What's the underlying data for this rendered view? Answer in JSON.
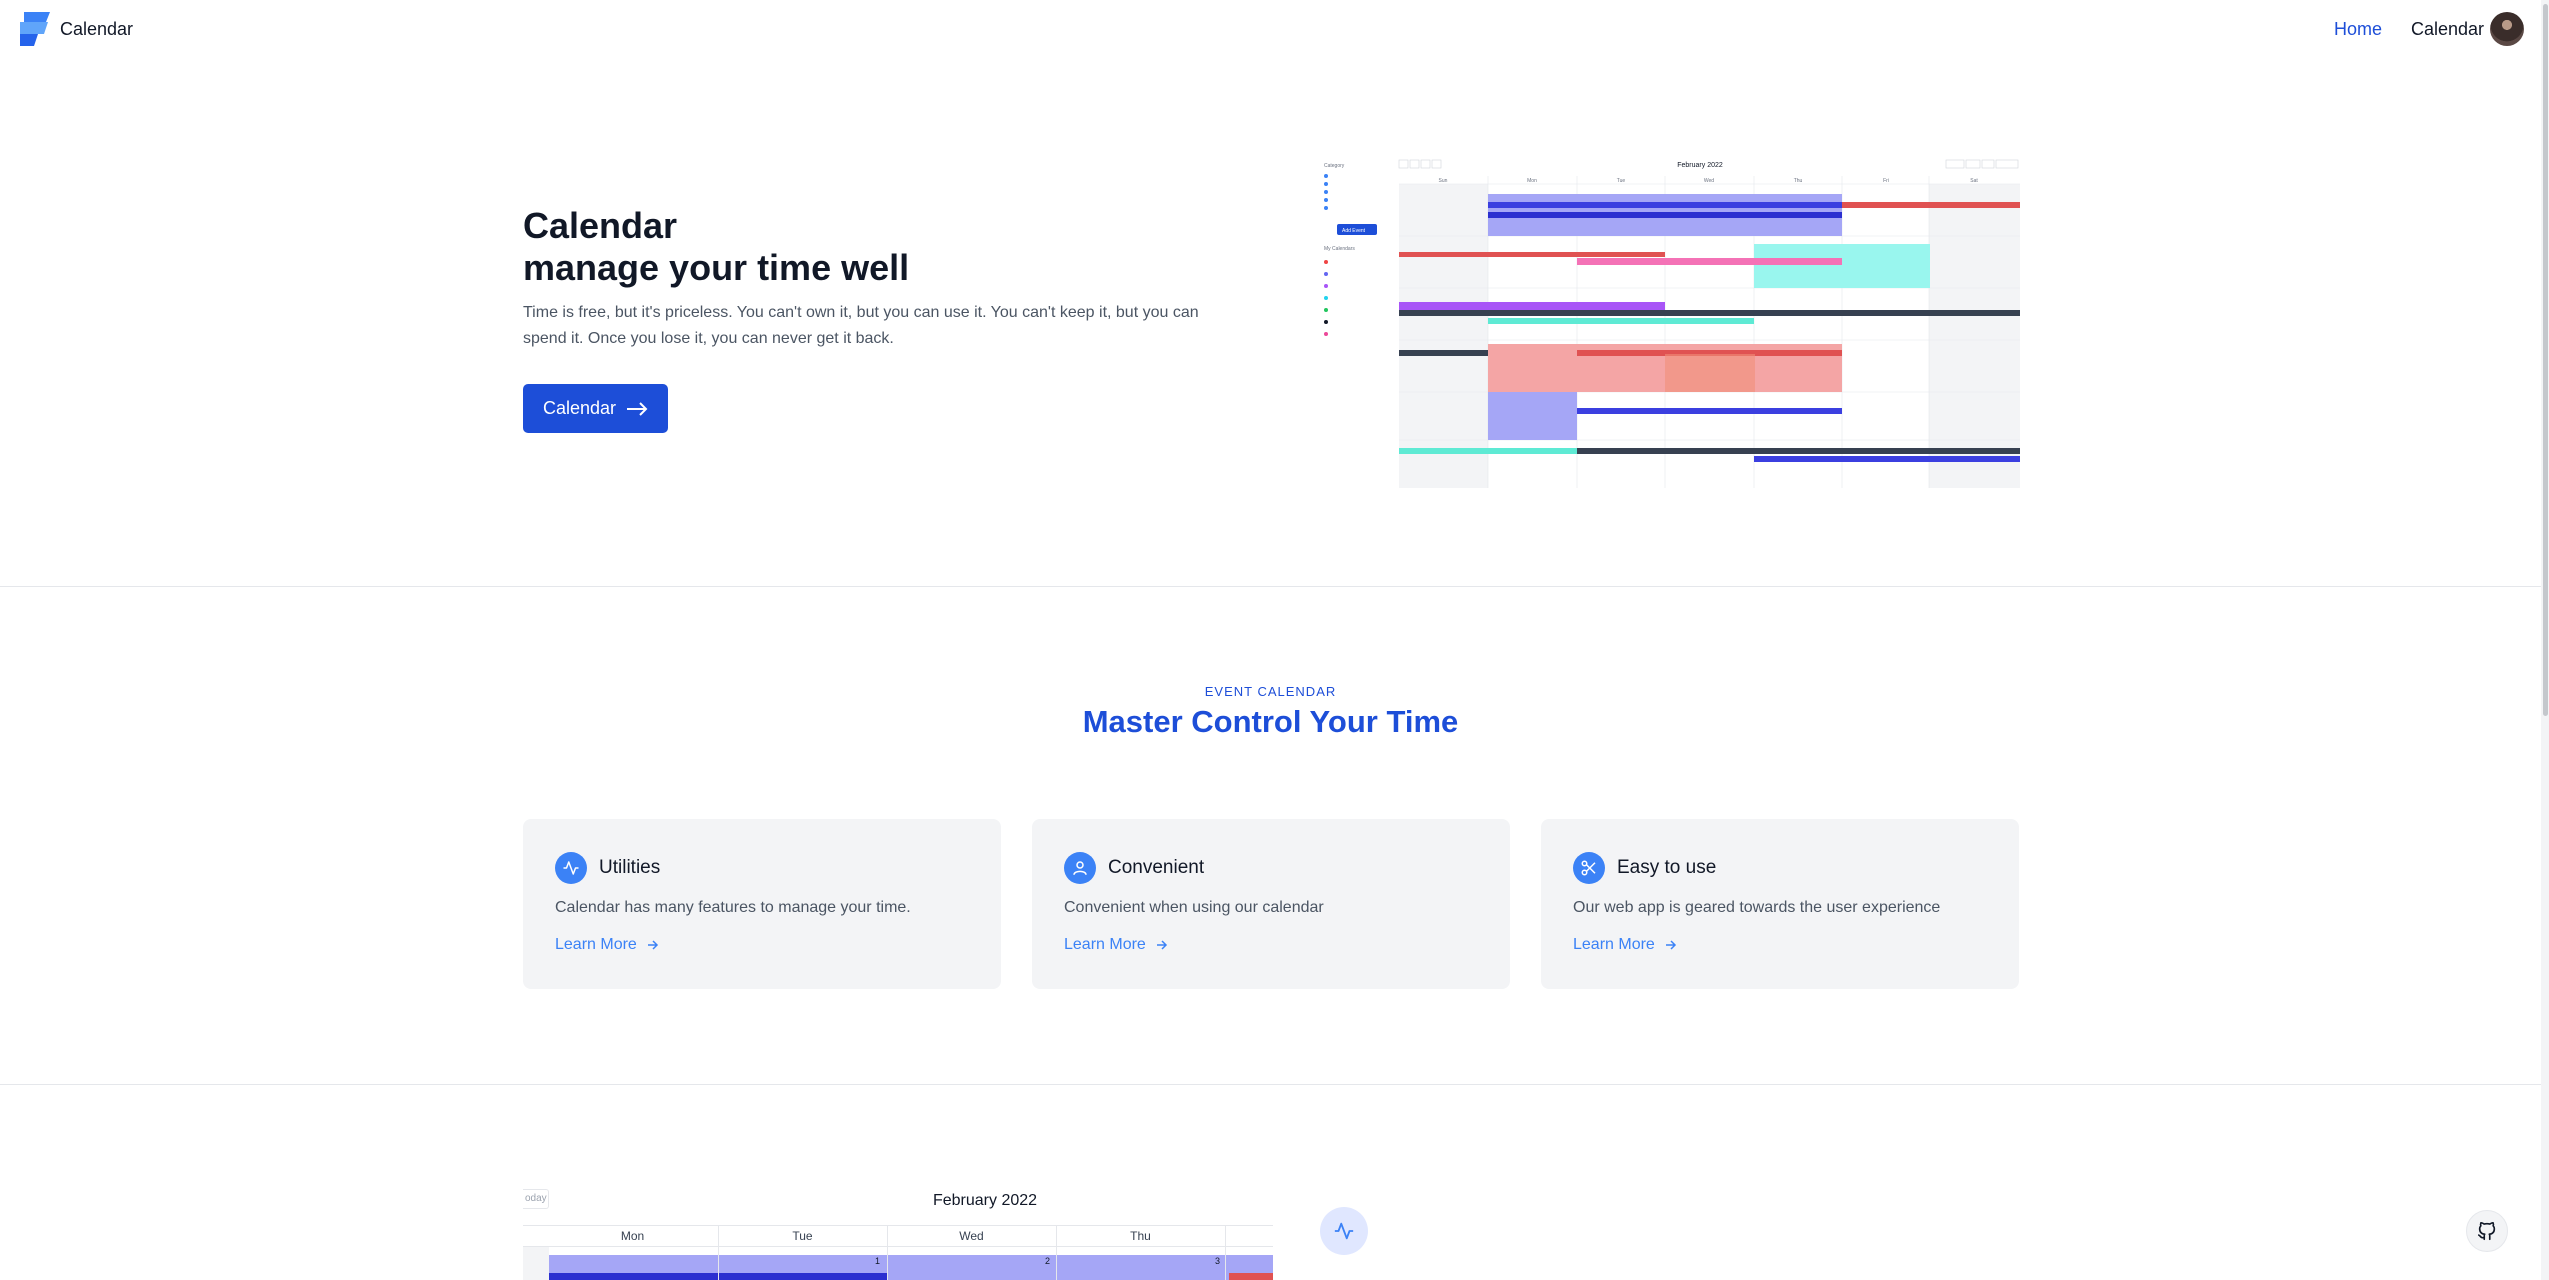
{
  "nav": {
    "brand": "Calendar",
    "links": [
      {
        "label": "Home",
        "active": true
      },
      {
        "label": "Calendar",
        "active": false
      }
    ],
    "logo_icon": "calendar-logo-icon",
    "avatar_icon": "user-avatar"
  },
  "hero": {
    "title_line1": "Calendar",
    "title_line2": "manage your time well",
    "description": "Time is free, but it's priceless. You can't own it, but you can use it. You can't keep it, but you can spend it. Once you lose it, you can never get it back.",
    "button_label": "Calendar",
    "button_icon": "arrow-right-icon",
    "preview": {
      "month_label": "February 2022",
      "weekdays": [
        "Sun",
        "Mon",
        "Tue",
        "Wed",
        "Thu",
        "Fri",
        "Sat"
      ],
      "add_event_label": "Add Event"
    }
  },
  "features": {
    "eyebrow": "EVENT CALENDAR",
    "title": "Master Control Your Time",
    "cards": [
      {
        "title": "Utilities",
        "text": "Calendar has many features to manage your time.",
        "link": "Learn More",
        "icon": "activity-icon"
      },
      {
        "title": "Convenient",
        "text": "Convenient when using our calendar",
        "link": "Learn More",
        "icon": "user-icon"
      },
      {
        "title": "Easy to use",
        "text": "Our web app is geared towards the user experience",
        "link": "Learn More",
        "icon": "scissors-icon"
      }
    ]
  },
  "calendar_preview": {
    "today_label": "oday",
    "month_label": "February 2022",
    "weekdays": [
      "Mon",
      "Tue",
      "Wed",
      "Thu"
    ],
    "dates": [
      "1",
      "2",
      "3"
    ]
  },
  "colors": {
    "accent": "#1d4ed8",
    "icon_blue": "#3b82f6",
    "card_bg": "#f3f4f6"
  },
  "github_icon": "github-icon"
}
